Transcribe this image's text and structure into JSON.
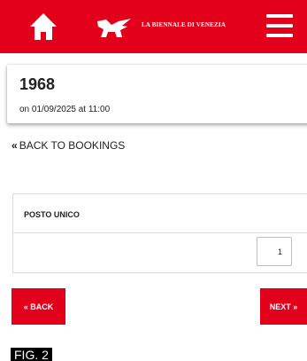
{
  "header": {
    "brand": "LA BIENNALE DI VENEZIA",
    "home_icon": "home-icon",
    "logo_icon": "winged-lion-icon",
    "menu_icon": "hamburger-menu-icon",
    "color": "#e2001a"
  },
  "event": {
    "title": "1968",
    "datetime": "on 01/09/2025 at 11:00"
  },
  "nav": {
    "back_to_bookings_glyph": "«",
    "back_to_bookings": "BACK TO BOOKINGS"
  },
  "ticket": {
    "name": "POSTO UNICO",
    "quantity": "1"
  },
  "buttons": {
    "back": "« BACK",
    "next": "NEXT »"
  },
  "caption": "FIG. 2"
}
